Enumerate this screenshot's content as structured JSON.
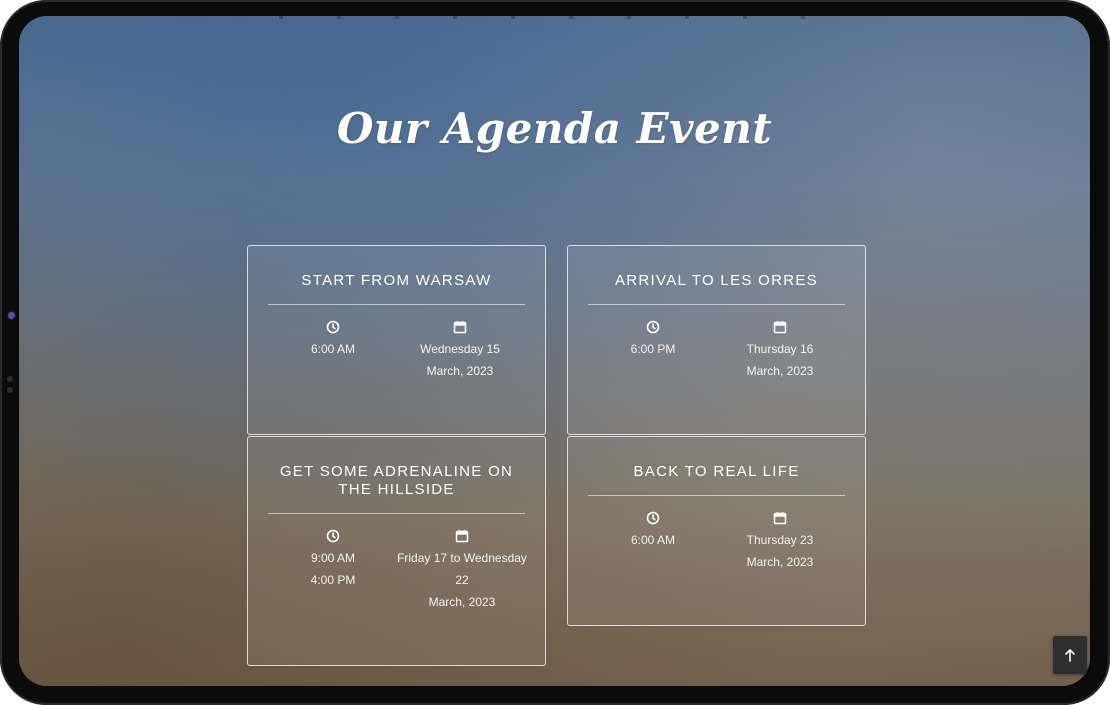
{
  "page": {
    "title": "Our Agenda Event"
  },
  "events": [
    {
      "title": "Start from Warsaw",
      "times": [
        "6:00 AM"
      ],
      "date_lines": [
        "Wednesday 15",
        "March, 2023"
      ]
    },
    {
      "title": "Arrival to Les Orres",
      "times": [
        "6:00 PM"
      ],
      "date_lines": [
        "Thursday 16",
        "March, 2023"
      ]
    },
    {
      "title": "Get some adrenaline on the hillside",
      "times": [
        "9:00 AM",
        "4:00 PM"
      ],
      "date_lines": [
        "Friday 17 to Wednesday",
        "22",
        "March, 2023"
      ]
    },
    {
      "title": "Back to real life",
      "times": [
        "6:00 AM"
      ],
      "date_lines": [
        "Thursday 23",
        "March, 2023"
      ]
    }
  ],
  "icons": {
    "time": "clock-icon",
    "date": "calendar-icon",
    "back_to_top": "arrow-up-icon"
  },
  "colors": {
    "card_border": "#ffffff",
    "text": "#ffffff",
    "back_to_top_bg": "#2f2f2f"
  }
}
